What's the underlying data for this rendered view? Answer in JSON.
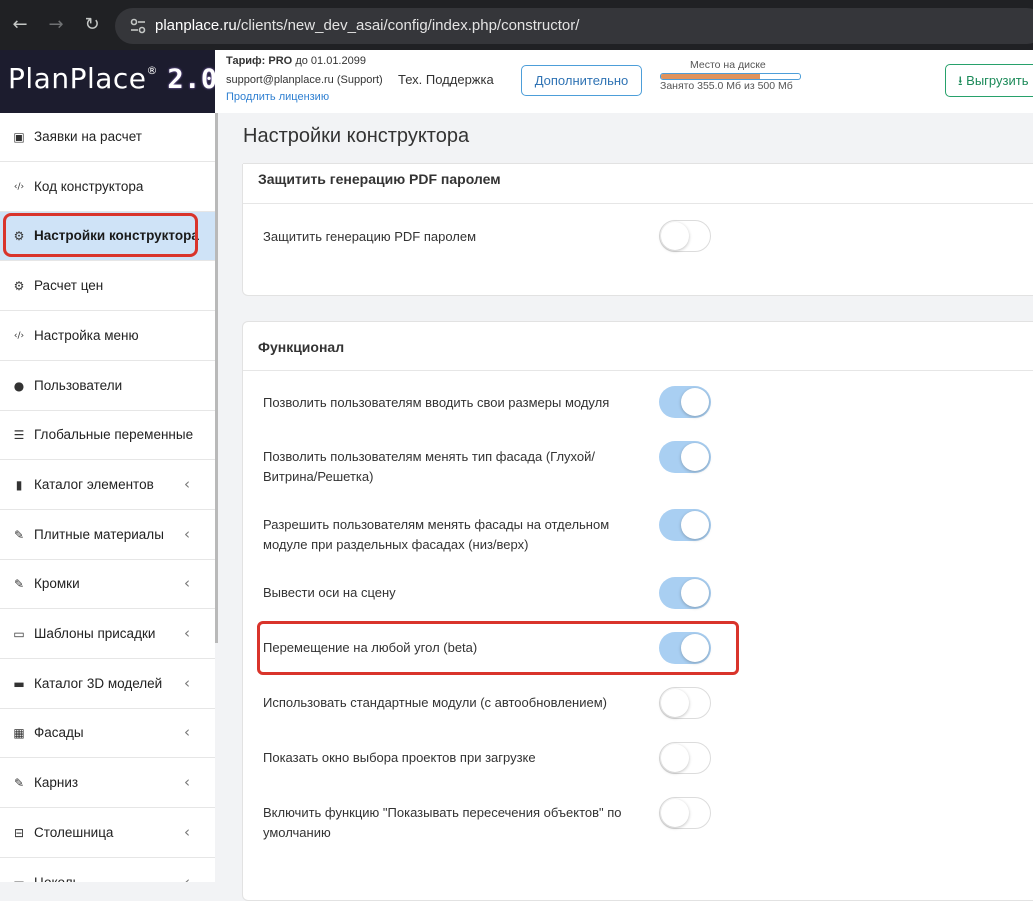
{
  "browser": {
    "url_domain": "planplace.ru",
    "url_path": "/clients/new_dev_asai/config/index.php/constructor/",
    "back_icon": "arrow-left-icon",
    "forward_icon": "arrow-right-icon",
    "reload_icon": "reload-icon"
  },
  "logo": {
    "text": "PlanPlace",
    "reg": "®",
    "version": "2.0"
  },
  "header": {
    "tariff_label": "Тариф:",
    "tariff_plan": "PRO",
    "tariff_until": "до 01.01.2099",
    "support_email": "support@planplace.ru (Support)",
    "renew_link": "Продлить лицензию",
    "tech_support": "Тех. Поддержка",
    "more_button": "Дополнительно",
    "disk_title": "Место на диске",
    "disk_used": "Занято 355.0 Мб из 500 Мб",
    "disk_fraction": 0.71,
    "upload_button": "Выгрузить"
  },
  "sidebar": {
    "items": [
      {
        "label": "Заявки на расчет",
        "icon": "calculator-icon"
      },
      {
        "label": "Код конструктора",
        "icon": "code-icon"
      },
      {
        "label": "Настройки конструктора",
        "icon": "gears-icon",
        "active": true
      },
      {
        "label": "Расчет цен",
        "icon": "gears-icon"
      },
      {
        "label": "Настройка меню",
        "icon": "code-icon"
      },
      {
        "label": "Пользователи",
        "icon": "user-icon"
      },
      {
        "label": "Глобальные переменные",
        "icon": "list-icon"
      },
      {
        "label": "Каталог элементов",
        "icon": "book-icon",
        "chevron": true
      },
      {
        "label": "Плитные материалы",
        "icon": "brush-icon",
        "chevron": true
      },
      {
        "label": "Кромки",
        "icon": "brush-icon",
        "chevron": true
      },
      {
        "label": "Шаблоны присадки",
        "icon": "window-icon",
        "chevron": true
      },
      {
        "label": "Каталог 3D моделей",
        "icon": "minus-icon",
        "chevron": true
      },
      {
        "label": "Фасады",
        "icon": "building-icon",
        "chevron": true
      },
      {
        "label": "Карниз",
        "icon": "brush-icon",
        "chevron": true
      },
      {
        "label": "Столешница",
        "icon": "minus-square-icon",
        "chevron": true
      },
      {
        "label": "Цоколь",
        "icon": "minus-icon",
        "chevron": true
      }
    ]
  },
  "main": {
    "title": "Настройки конструктора",
    "pdf_card": {
      "title": "Защитить генерацию PDF паролем",
      "option": {
        "label": "Защитить генерацию PDF паролем",
        "enabled": false
      }
    },
    "func_card": {
      "title": "Функционал",
      "options": [
        {
          "label": "Позволить пользователям вводить свои размеры модуля",
          "enabled": true
        },
        {
          "label": "Позволить пользователям менять тип фасада (Глухой/ Витрина/Решетка)",
          "enabled": true
        },
        {
          "label": "Разрешить пользователям менять фасады на отдельном модуле при раздельных фасадах (низ/верх)",
          "enabled": true
        },
        {
          "label": "Вывести оси на сцену",
          "enabled": true
        },
        {
          "label": "Перемещение на любой угол (beta)",
          "enabled": true
        },
        {
          "label": "Использовать стандартные модули (с автообновлением)",
          "enabled": false
        },
        {
          "label": "Показать окно выбора проектов при загрузке",
          "enabled": false
        },
        {
          "label": "Включить функцию \"Показывать пересечения объектов\" по умолчанию",
          "enabled": false
        }
      ]
    }
  },
  "colors": {
    "highlight": "#d9342b",
    "toggle_on": "#a9cff2",
    "active_item": "#cfe3f7",
    "link": "#2e7fd1",
    "upload_green": "#1c8a59"
  }
}
